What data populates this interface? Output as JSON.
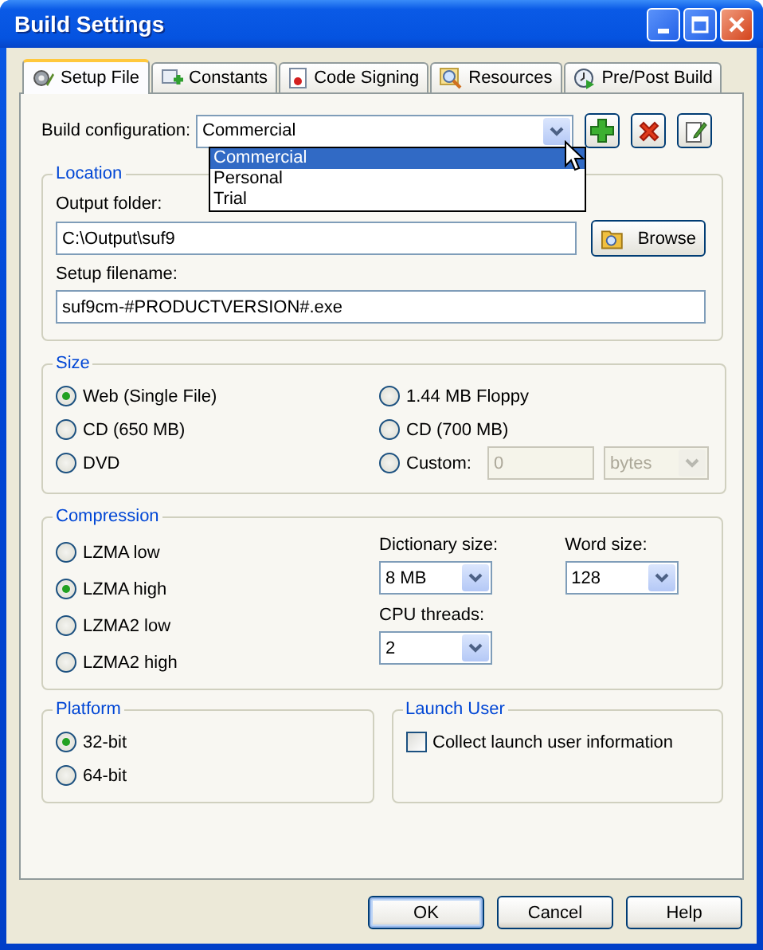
{
  "window": {
    "title": "Build Settings"
  },
  "tabs": [
    {
      "label": "Setup File",
      "selected": true,
      "kind": "gear"
    },
    {
      "label": "Constants",
      "selected": false,
      "kind": "constants"
    },
    {
      "label": "Code Signing",
      "selected": false,
      "kind": "certificate"
    },
    {
      "label": "Resources",
      "selected": false,
      "kind": "magnifier"
    },
    {
      "label": "Pre/Post Build",
      "selected": false,
      "kind": "clock"
    }
  ],
  "build_configuration": {
    "label": "Build configuration:",
    "value": "Commercial",
    "expanded": true,
    "options": [
      {
        "label": "Commercial",
        "selected": true
      },
      {
        "label": "Personal",
        "selected": false
      },
      {
        "label": "Trial",
        "selected": false
      }
    ]
  },
  "location": {
    "title": "Location",
    "output_folder_label": "Output folder:",
    "output_folder": "C:\\Output\\suf9",
    "browse_button": "Browse",
    "setup_filename_label": "Setup filename:",
    "setup_filename": "suf9cm-#PRODUCTVERSION#.exe"
  },
  "size": {
    "title": "Size",
    "options": [
      {
        "label": "Web (Single File)",
        "selected": true,
        "kind": "plain"
      },
      {
        "label": "1.44 MB Floppy",
        "selected": false,
        "kind": "plain"
      },
      {
        "label": "CD (650 MB)",
        "selected": false,
        "kind": "plain"
      },
      {
        "label": "CD (700 MB)",
        "selected": false,
        "kind": "plain"
      },
      {
        "label": "DVD",
        "selected": false,
        "kind": "plain"
      },
      {
        "label": "Custom:",
        "selected": false,
        "kind": "custom"
      }
    ],
    "custom_value": "0",
    "custom_unit": "bytes",
    "custom_disabled": true
  },
  "compression": {
    "title": "Compression",
    "options": [
      {
        "label": "LZMA low",
        "selected": false
      },
      {
        "label": "LZMA high",
        "selected": true
      },
      {
        "label": "LZMA2 low",
        "selected": false
      },
      {
        "label": "LZMA2 high",
        "selected": false
      }
    ],
    "dictionary_size": {
      "label": "Dictionary size:",
      "value": "8 MB"
    },
    "word_size": {
      "label": "Word size:",
      "value": "128"
    },
    "cpu_threads": {
      "label": "CPU threads:",
      "value": "2"
    }
  },
  "platform": {
    "title": "Platform",
    "options": [
      {
        "label": "32-bit",
        "selected": true
      },
      {
        "label": "64-bit",
        "selected": false
      }
    ]
  },
  "launch_user": {
    "title": "Launch User",
    "label": "Collect launch user information",
    "checked": false
  },
  "buttons": [
    {
      "label": "OK",
      "default": true
    },
    {
      "label": "Cancel",
      "default": false
    },
    {
      "label": "Help",
      "default": false
    }
  ]
}
